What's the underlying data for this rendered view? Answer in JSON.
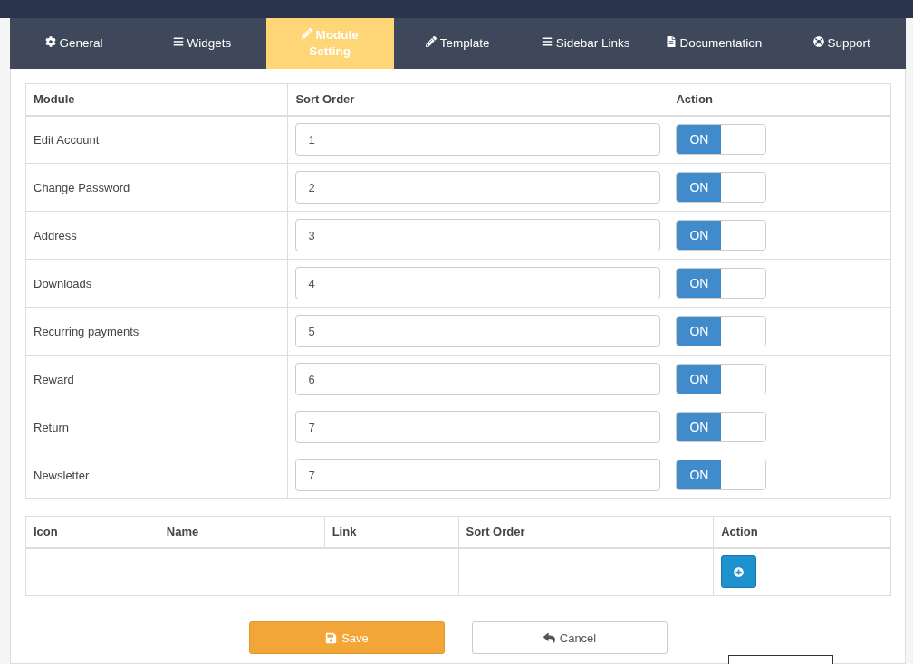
{
  "tabs": [
    {
      "label": "General",
      "kind": "gear",
      "selected": false
    },
    {
      "label": "Widgets",
      "kind": "bars",
      "selected": false
    },
    {
      "label": "Module Setting",
      "kind": "pencil",
      "selected": true
    },
    {
      "label": "Template",
      "kind": "pencil",
      "selected": false
    },
    {
      "label": "Sidebar Links",
      "kind": "bars",
      "selected": false
    },
    {
      "label": "Documentation",
      "kind": "file",
      "selected": false
    },
    {
      "label": "Support",
      "kind": "lifering",
      "selected": false
    }
  ],
  "modules": {
    "columns": [
      "Module",
      "Sort Order",
      "Action"
    ],
    "rows": [
      {
        "name": "Edit Account",
        "sort_order": "1",
        "toggle": "ON",
        "on": true
      },
      {
        "name": "Change Password",
        "sort_order": "2",
        "toggle": "ON",
        "on": true
      },
      {
        "name": "Address",
        "sort_order": "3",
        "toggle": "ON",
        "on": true
      },
      {
        "name": "Downloads",
        "sort_order": "4",
        "toggle": "ON",
        "on": true
      },
      {
        "name": "Recurring payments",
        "sort_order": "5",
        "toggle": "ON",
        "on": true
      },
      {
        "name": "Reward",
        "sort_order": "6",
        "toggle": "ON",
        "on": true
      },
      {
        "name": "Return",
        "sort_order": "7",
        "toggle": "ON",
        "on": true
      },
      {
        "name": "Newsletter",
        "sort_order": "7",
        "toggle": "ON",
        "on": true
      }
    ]
  },
  "links": {
    "columns": [
      "Icon",
      "Name",
      "Link",
      "Sort Order",
      "Action"
    ]
  },
  "buttons": [
    {
      "kind": "save",
      "label": "Save"
    },
    {
      "kind": "cancel",
      "label": "Cancel"
    }
  ]
}
